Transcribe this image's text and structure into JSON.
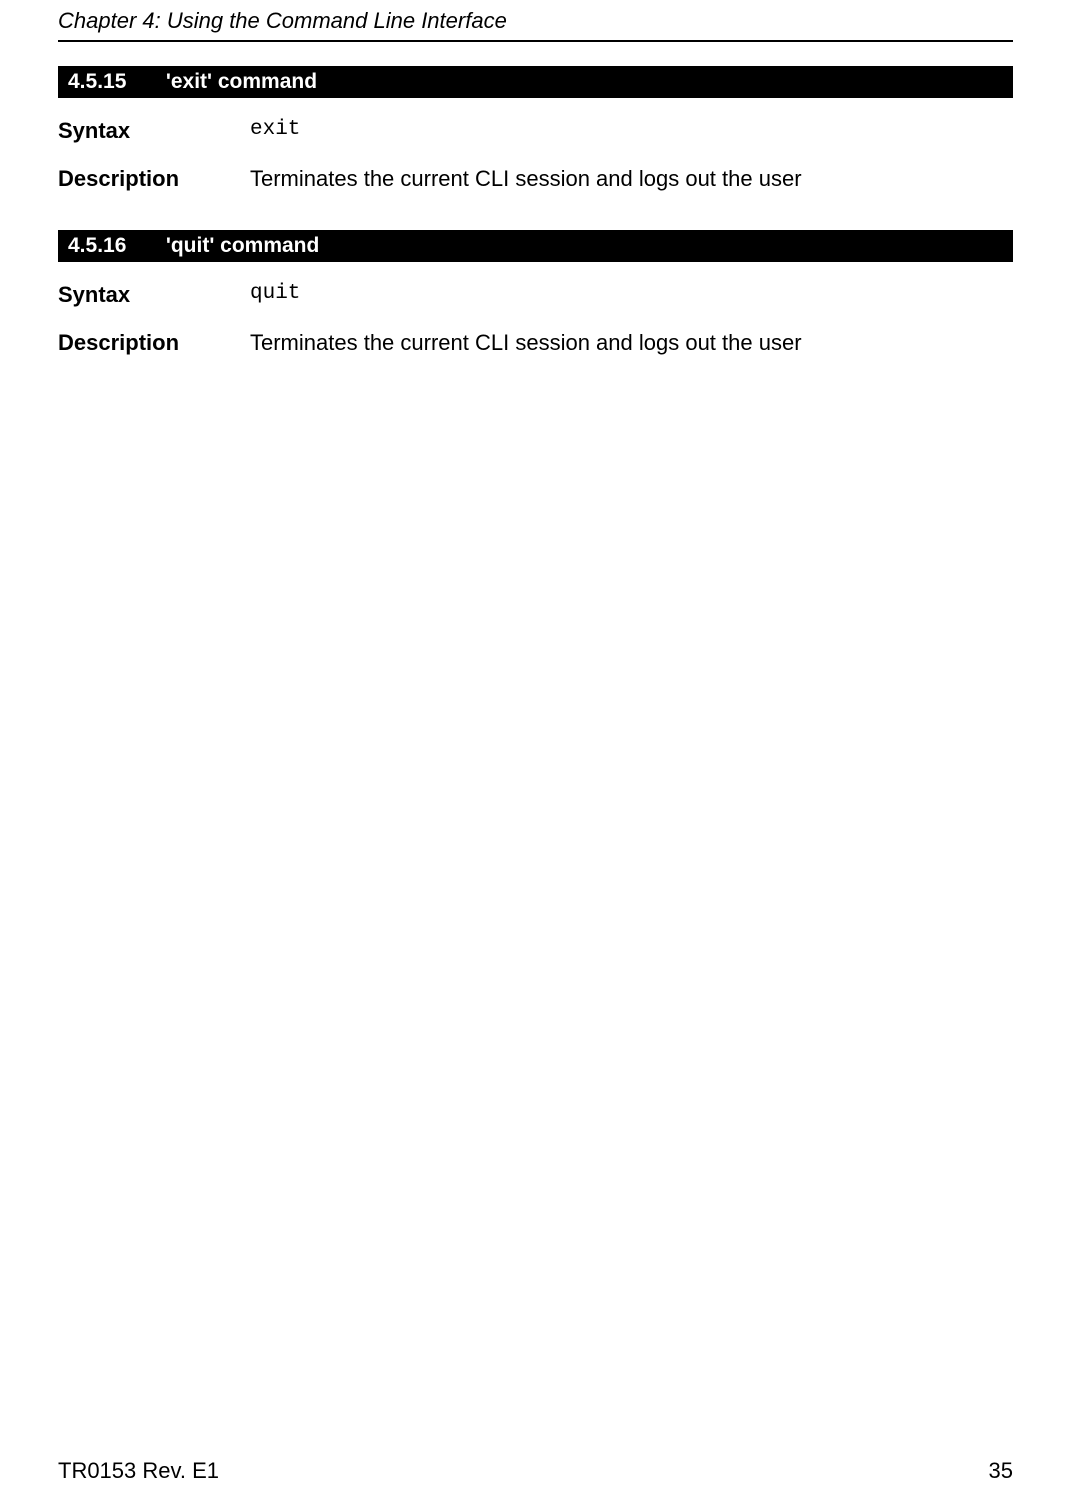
{
  "header": {
    "chapter": "Chapter 4: Using the Command Line Interface"
  },
  "sections": [
    {
      "number": "4.5.15",
      "title": "'exit' command",
      "syntax_label": "Syntax",
      "syntax_value": "exit",
      "description_label": "Description",
      "description_value": "Terminates the current CLI session and logs out the user"
    },
    {
      "number": "4.5.16",
      "title": "'quit' command",
      "syntax_label": "Syntax",
      "syntax_value": "quit",
      "description_label": "Description",
      "description_value": "Terminates the current CLI session and logs out the user"
    }
  ],
  "footer": {
    "doc_rev": "TR0153 Rev. E1",
    "page": "35"
  }
}
